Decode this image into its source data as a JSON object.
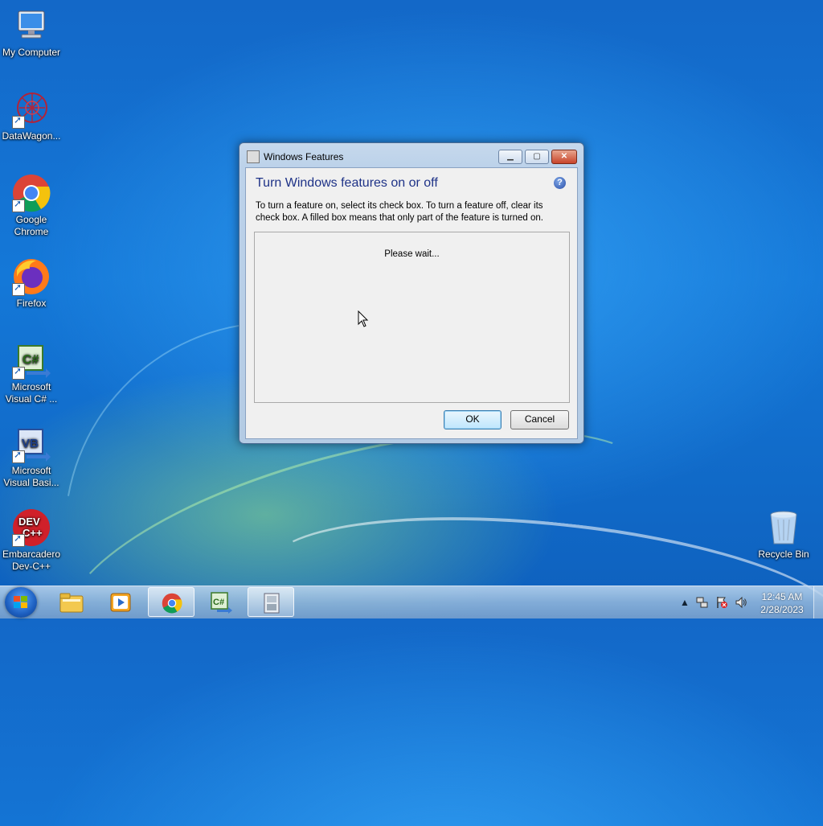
{
  "desktop": {
    "icons": [
      {
        "label": "My Computer"
      },
      {
        "label": "DataWagon..."
      },
      {
        "label": "Google Chrome"
      },
      {
        "label": "Firefox"
      },
      {
        "label": "Microsoft Visual C# ..."
      },
      {
        "label": "Microsoft Visual Basi..."
      },
      {
        "label": "Embarcadero Dev-C++"
      },
      {
        "label": "Recycle Bin"
      }
    ]
  },
  "dialog": {
    "title": "Windows Features",
    "heading": "Turn Windows features on or off",
    "help_icon": "help-icon",
    "description": "To turn a feature on, select its check box. To turn a feature off, clear its check box. A filled box means that only part of the feature is turned on.",
    "list_status": "Please wait...",
    "ok_label": "OK",
    "cancel_label": "Cancel"
  },
  "taskbar": {
    "items": [
      "windows-explorer-icon",
      "media-player-icon",
      "chrome-icon",
      "visual-csharp-icon",
      "windows-features-icon"
    ],
    "tray": {
      "time": "12:45 AM",
      "date": "2/28/2023"
    }
  },
  "colors": {
    "desktop_blue": "#1470d4",
    "heading_blue": "#1e3287",
    "close_red": "#c8442a"
  }
}
